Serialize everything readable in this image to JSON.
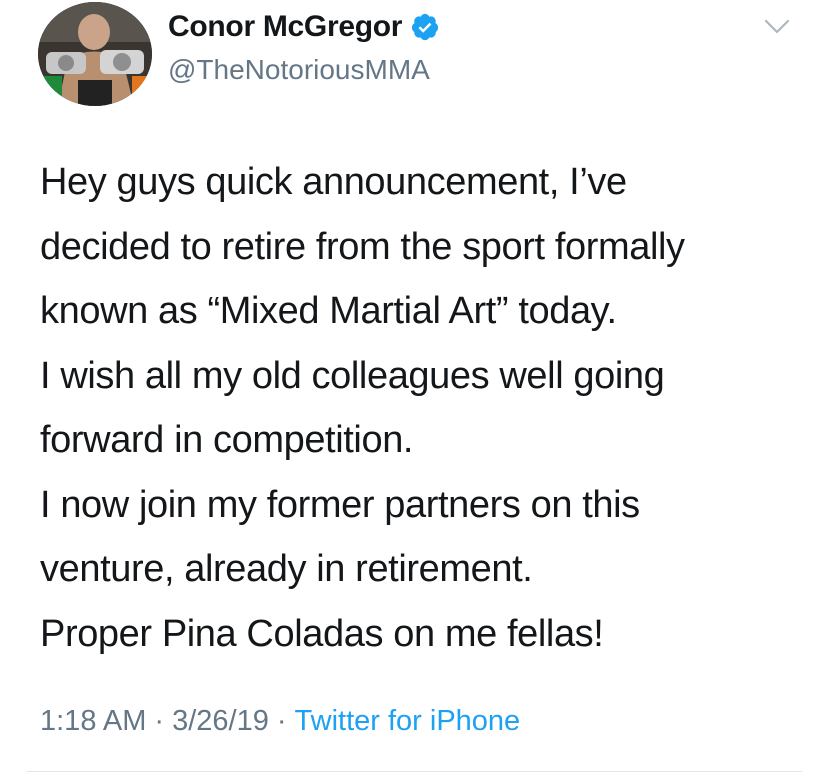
{
  "user": {
    "display_name": "Conor McGregor",
    "handle": "@TheNotoriousMMA",
    "verified": true
  },
  "tweet": {
    "lines": [
      "Hey guys quick announcement, I’ve",
      "decided to retire from the sport formally",
      "known as “Mixed Martial Art” today.",
      "I wish all my old colleagues well going",
      "forward in competition.",
      "I now join my former partners on this",
      "venture, already in retirement.",
      "Proper Pina Coladas on me fellas!"
    ],
    "time": "1:18 AM",
    "date": "3/26/19",
    "source": "Twitter for iPhone",
    "separator": "·"
  },
  "icons": {
    "verified": "verified-badge-icon",
    "menu": "chevron-down-icon"
  },
  "colors": {
    "text": "#14171a",
    "secondary": "#657786",
    "link": "#1da1f2",
    "verified": "#1da1f2",
    "divider": "#e1e8ed"
  }
}
